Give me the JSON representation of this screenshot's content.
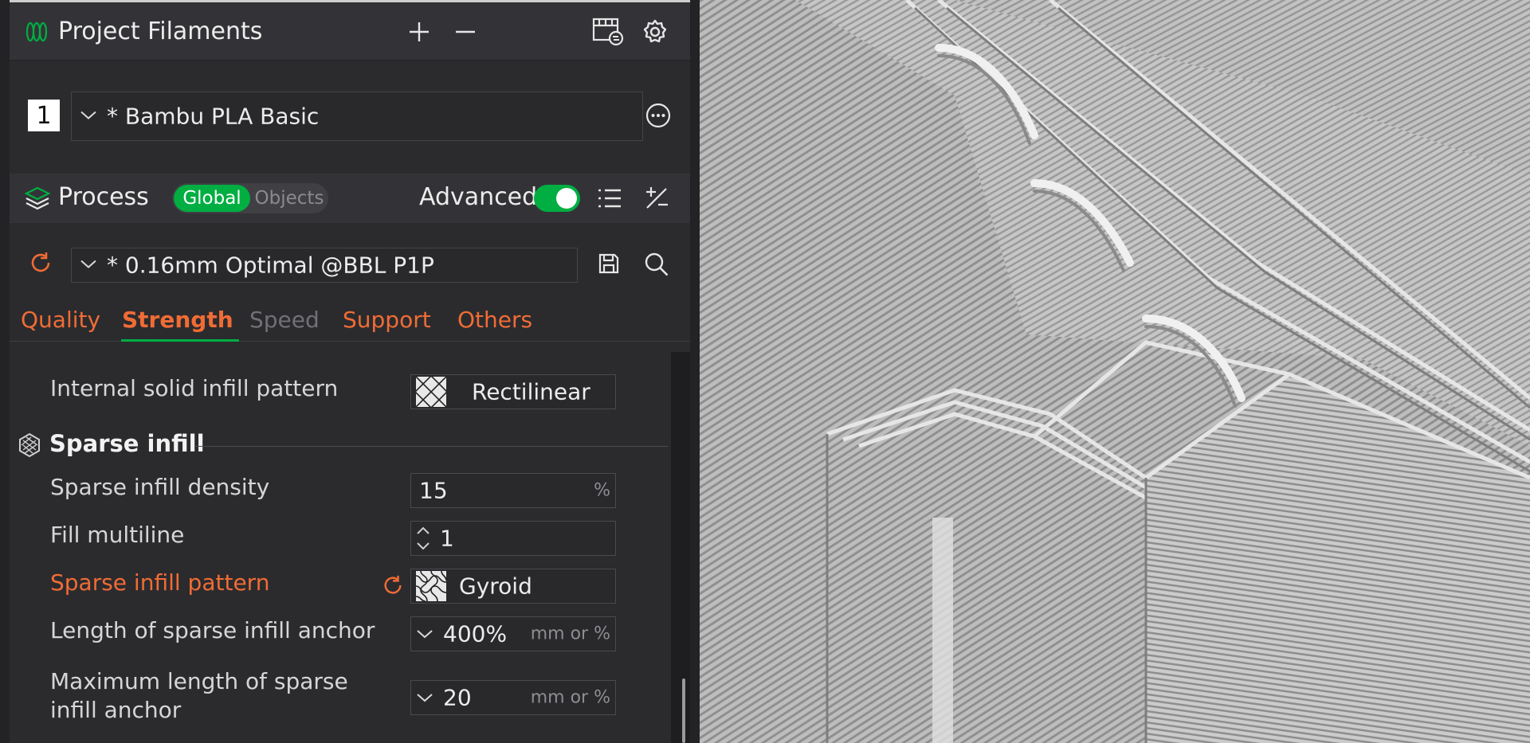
{
  "filaments": {
    "title": "Project Filaments",
    "icons": [
      "filament-icon",
      "add-icon",
      "remove-icon",
      "sync-filament-icon",
      "gear-icon"
    ],
    "items": [
      {
        "slot": "1",
        "name": "* Bambu PLA Basic",
        "swatch": "#ffffff"
      }
    ]
  },
  "process": {
    "title": "Process",
    "mode_global": "Global",
    "mode_objects": "Objects",
    "advanced_label": "Advanced",
    "advanced_on": true,
    "preset": "* 0.16mm Optimal @BBL P1P"
  },
  "tabs": [
    {
      "label": "Quality",
      "state": "modified"
    },
    {
      "label": "Strength",
      "state": "active"
    },
    {
      "label": "Speed",
      "state": "disabled"
    },
    {
      "label": "Support",
      "state": "modified"
    },
    {
      "label": "Others",
      "state": "modified"
    }
  ],
  "settings": {
    "internal_solid_infill_pattern": {
      "label": "Internal solid infill pattern",
      "value": "Rectilinear"
    },
    "sparse_infill_section": "Sparse infill",
    "sparse_infill_density": {
      "label": "Sparse infill density",
      "value": "15",
      "unit": "%"
    },
    "fill_multiline": {
      "label": "Fill multiline",
      "value": "1"
    },
    "sparse_infill_pattern": {
      "label": "Sparse infill pattern",
      "value": "Gyroid"
    },
    "anchor_length": {
      "label": "Length of sparse infill anchor",
      "value": "400%",
      "unit": "mm or %"
    },
    "anchor_max_line1": "Maximum length of sparse",
    "anchor_max_line2": "infill anchor",
    "anchor_max": {
      "value": "20",
      "unit": "mm or %"
    }
  },
  "colors": {
    "accent_green": "#00ae42",
    "modified_orange": "#f06c35",
    "panel_bg": "#2b2b2e"
  }
}
